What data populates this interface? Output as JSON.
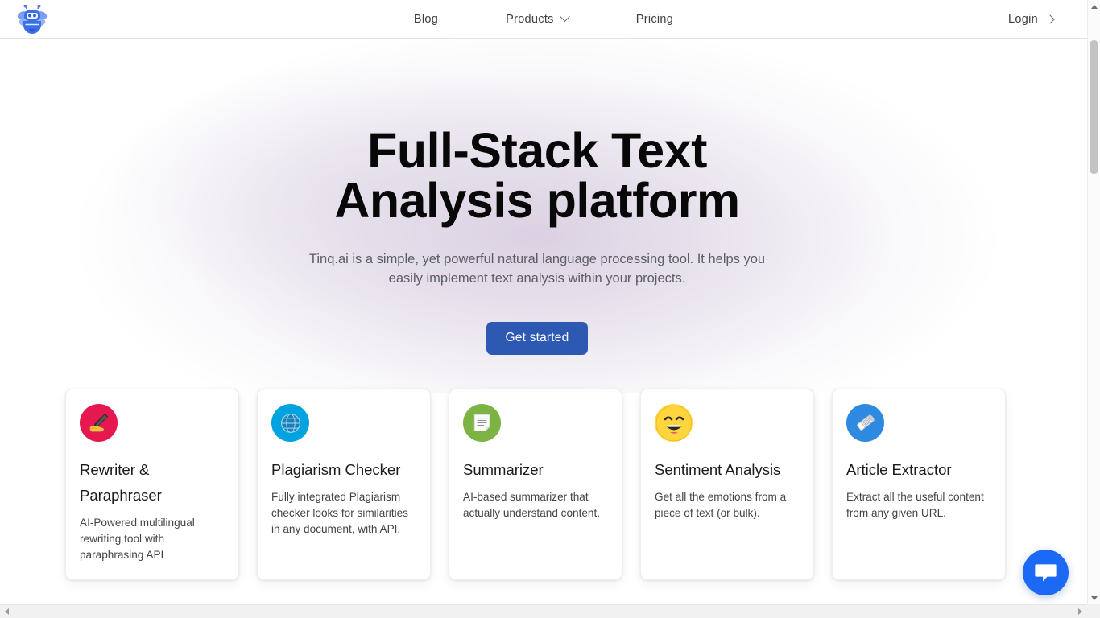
{
  "header": {
    "logo_icon": "tinq-robot-bee-logo",
    "nav": [
      {
        "label": "Blog",
        "has_dropdown": false
      },
      {
        "label": "Products",
        "has_dropdown": true,
        "dropdown_icon": "chevron-down-icon"
      },
      {
        "label": "Pricing",
        "has_dropdown": false
      }
    ],
    "login": {
      "label": "Login",
      "icon": "chevron-right-icon"
    }
  },
  "hero": {
    "title_line1": "Full-Stack Text",
    "title_line2": "Analysis platform",
    "subtitle": "Tinq.ai is a simple, yet powerful natural language processing tool. It helps you easily implement text analysis within your projects.",
    "cta_label": "Get started",
    "cta_color": "#2d59b3"
  },
  "cards": [
    {
      "title": "Rewriter & Paraphraser",
      "description": "AI-Powered multilingual rewriting tool with paraphrasing API",
      "icon": "writing-hand-icon",
      "icon_bg": "#e5184f"
    },
    {
      "title": "Plagiarism Checker",
      "description": "Fully integrated Plagiarism checker looks for similarities in any document, with API.",
      "icon": "globe-icon",
      "icon_bg": "#00a3e0"
    },
    {
      "title": "Summarizer",
      "description": "AI-based summarizer that actually understand content.",
      "icon": "document-page-icon",
      "icon_bg": "#7cb342"
    },
    {
      "title": "Sentiment Analysis",
      "description": "Get all the emotions from a piece of text (or bulk).",
      "icon": "grinning-face-icon",
      "icon_bg": "#ffd53e"
    },
    {
      "title": "Article Extractor",
      "description": "Extract all the useful content from any given URL.",
      "icon": "rolled-newspaper-icon",
      "icon_bg": "#2d8ae0"
    }
  ],
  "chat": {
    "icon": "chat-bubble-icon",
    "color": "#1c69f5"
  },
  "scrollbars": {
    "vertical": {
      "up_icon": "scroll-up-arrow-icon",
      "down_icon": "scroll-down-arrow-icon"
    },
    "horizontal": {
      "left_icon": "scroll-left-arrow-icon",
      "right_icon": "scroll-right-arrow-icon"
    }
  }
}
